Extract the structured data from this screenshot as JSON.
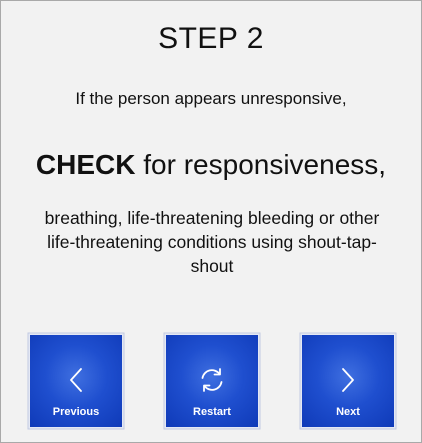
{
  "step": {
    "title": "STEP 2",
    "intro": "If the person appears unresponsive,",
    "headline_strong": "CHECK",
    "headline_rest": " for responsiveness,",
    "detail": "breathing, life-threatening bleeding or other life-threatening conditions using shout-tap-shout"
  },
  "nav": {
    "previous_label": "Previous",
    "restart_label": "Restart",
    "next_label": "Next",
    "previous_icon": "chevron-left-icon",
    "restart_icon": "refresh-icon",
    "next_icon": "chevron-right-icon"
  },
  "colors": {
    "button_blue": "#1f4fcf",
    "background": "#f2f2f2",
    "text": "#111111"
  }
}
